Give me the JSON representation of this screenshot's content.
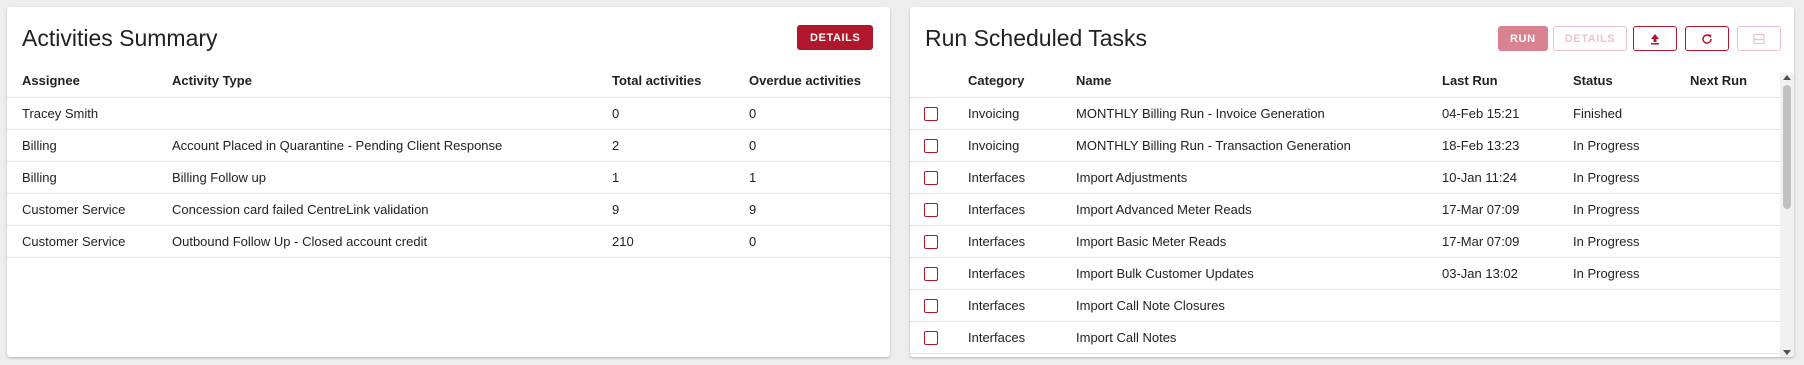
{
  "activities": {
    "title": "Activities Summary",
    "details_label": "DETAILS",
    "columns": [
      "Assignee",
      "Activity Type",
      "Total activities",
      "Overdue activities"
    ],
    "rows": [
      [
        "Tracey Smith",
        "",
        "0",
        "0"
      ],
      [
        "Billing",
        "Account Placed in Quarantine - Pending Client Response",
        "2",
        "0"
      ],
      [
        "Billing",
        "Billing Follow up",
        "1",
        "1"
      ],
      [
        "Customer Service",
        "Concession card failed CentreLink validation",
        "9",
        "9"
      ],
      [
        "Customer Service",
        "Outbound Follow Up - Closed account credit",
        "210",
        "0"
      ]
    ]
  },
  "scheduled": {
    "title": "Run Scheduled Tasks",
    "run_label": "RUN",
    "details_label": "DETAILS",
    "icons": [
      "upload-icon",
      "refresh-icon",
      "panel-toggle-icon"
    ],
    "columns": [
      "",
      "Category",
      "Name",
      "Last Run",
      "Status",
      "Next Run"
    ],
    "rows": [
      [
        "Invoicing",
        "MONTHLY Billing Run - Invoice Generation",
        "04-Feb 15:21",
        "Finished",
        ""
      ],
      [
        "Invoicing",
        "MONTHLY Billing Run - Transaction Generation",
        "18-Feb 13:23",
        "In Progress",
        ""
      ],
      [
        "Interfaces",
        "Import Adjustments",
        "10-Jan 11:24",
        "In Progress",
        ""
      ],
      [
        "Interfaces",
        "Import Advanced Meter Reads",
        "17-Mar 07:09",
        "In Progress",
        ""
      ],
      [
        "Interfaces",
        "Import Basic Meter Reads",
        "17-Mar 07:09",
        "In Progress",
        ""
      ],
      [
        "Interfaces",
        "Import Bulk Customer Updates",
        "03-Jan 13:02",
        "In Progress",
        ""
      ],
      [
        "Interfaces",
        "Import Call Note Closures",
        "",
        "",
        ""
      ],
      [
        "Interfaces",
        "Import Call Notes",
        "",
        "",
        ""
      ]
    ]
  },
  "colors": {
    "accent": "#b0172d",
    "accent_disabled": "#d98291",
    "background": "#eeeeee"
  }
}
